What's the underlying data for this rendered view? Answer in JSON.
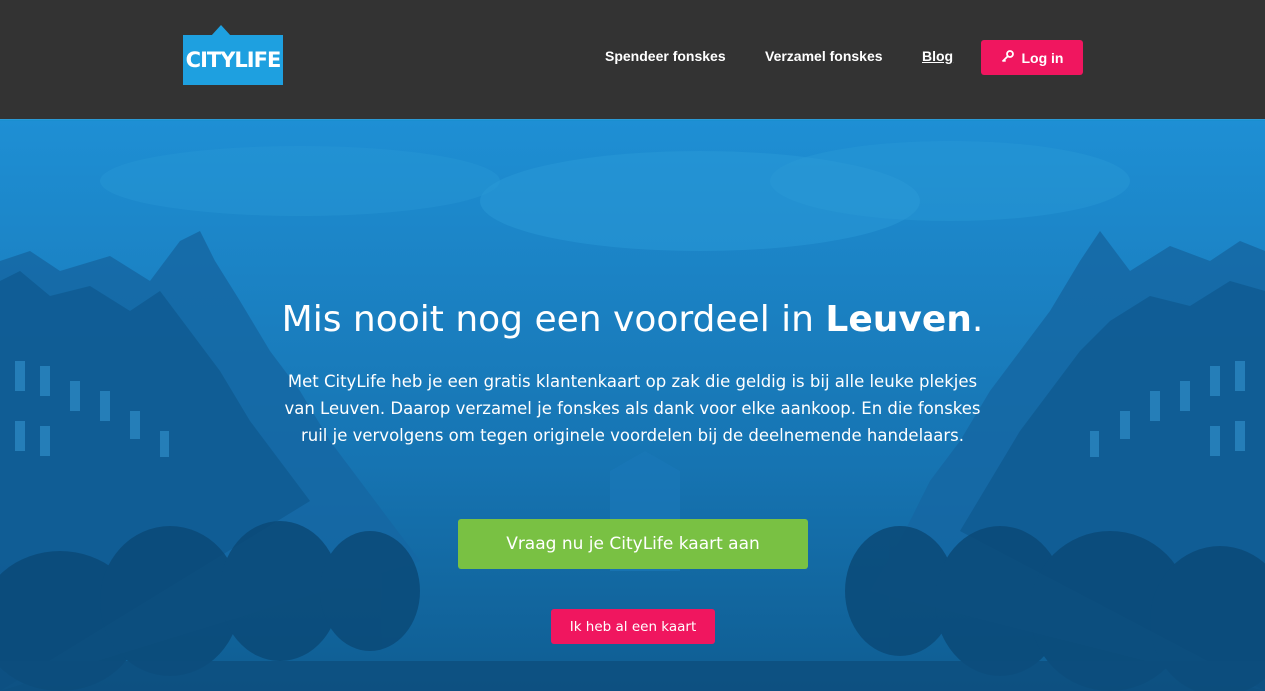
{
  "header": {
    "logo_text": "CITYLIFE",
    "nav": [
      {
        "label": "Spendeer fonskes"
      },
      {
        "label": "Verzamel fonskes"
      },
      {
        "label": "Blog"
      }
    ],
    "login_label": "Log in",
    "login_icon": "key-icon"
  },
  "hero": {
    "title_main": "Mis nooit nog een voordeel in ",
    "title_bold": "Leuven",
    "title_end": ".",
    "text": "Met CityLife heb je een gratis klantenkaart op zak die geldig is bij alle leuke plekjes van Leuven. Daarop verzamel je fonskes als dank voor elke aankoop. En die fonskes ruil je vervolgens om tegen originele voordelen bij de deelnemende handelaars.",
    "cta_label": "Vraag nu je CityLife kaart aan",
    "secondary_label": "Ik heb al een kaart"
  },
  "colors": {
    "header_bg": "#333333",
    "brand_blue": "#1ea0e0",
    "pink": "#f0165f",
    "green": "#79c143"
  }
}
